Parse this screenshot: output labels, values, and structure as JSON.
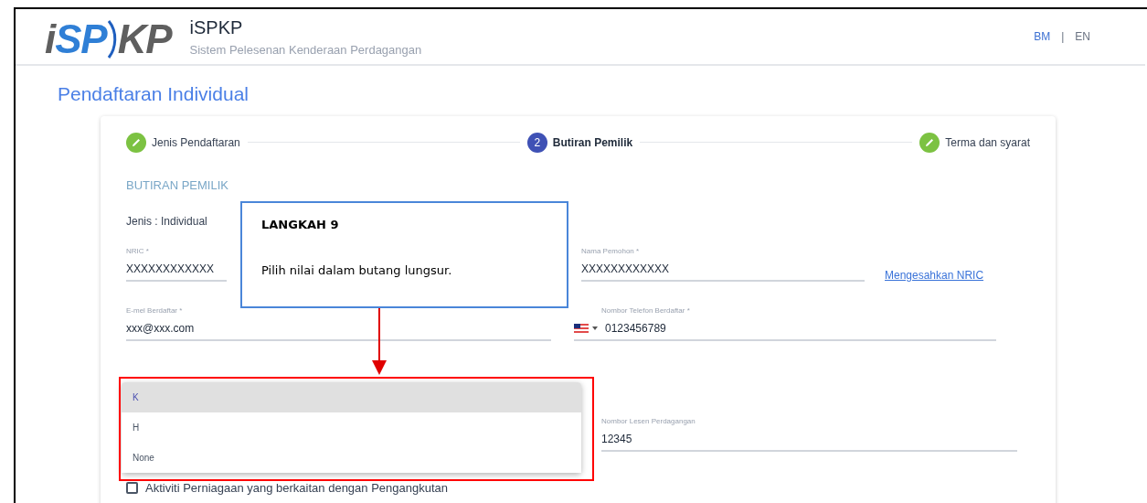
{
  "header": {
    "logo_parts": [
      {
        "text": "i",
        "color": "#5f5f5f"
      },
      {
        "text": "SP",
        "color": "#2f7fd6"
      },
      {
        "text": "KP",
        "color": "#5f5f5f"
      }
    ],
    "title": "iSPKP",
    "subtitle": "Sistem Pelesenan Kenderaan Perdagangan",
    "languages": [
      {
        "label": "BM",
        "selected": true
      },
      {
        "label": "EN",
        "selected": false
      }
    ],
    "separator": "|"
  },
  "page_title": "Pendaftaran Individual",
  "steps": [
    {
      "kind": "done",
      "label": "Jenis Pendaftaran"
    },
    {
      "kind": "active",
      "number": "2",
      "label": "Butiran Pemilik"
    },
    {
      "kind": "done",
      "label": "Terma dan syarat"
    }
  ],
  "section_title": "BUTIRAN PEMILIK",
  "jenis": "Jenis : Individual",
  "fields": {
    "nric": {
      "label": "NRIC *",
      "value": "XXXXXXXXXXXX"
    },
    "nama": {
      "label": "Nama Pemohon *",
      "value": "XXXXXXXXXXXX"
    },
    "verify_link": "Mengesahkan NRIC",
    "email": {
      "label": "E-mel Berdaftar *",
      "value": "xxx@xxx.com"
    },
    "phone": {
      "label": "Nombor Telefon Berdaftar *",
      "value": "0123456789"
    },
    "license": {
      "label": "Nombor Lesen Perdagangan",
      "value": "12345"
    }
  },
  "dropdown_options": [
    {
      "label": "K",
      "selected": true
    },
    {
      "label": "H",
      "selected": false
    },
    {
      "label": "None",
      "selected": false
    }
  ],
  "checkbox": {
    "label": "Aktiviti Perniagaan yang berkaitan dengan Pengangkutan",
    "checked": false
  },
  "callout": {
    "title": "LANGKAH 9",
    "text": "Pilih nilai dalam butang lungsur."
  }
}
